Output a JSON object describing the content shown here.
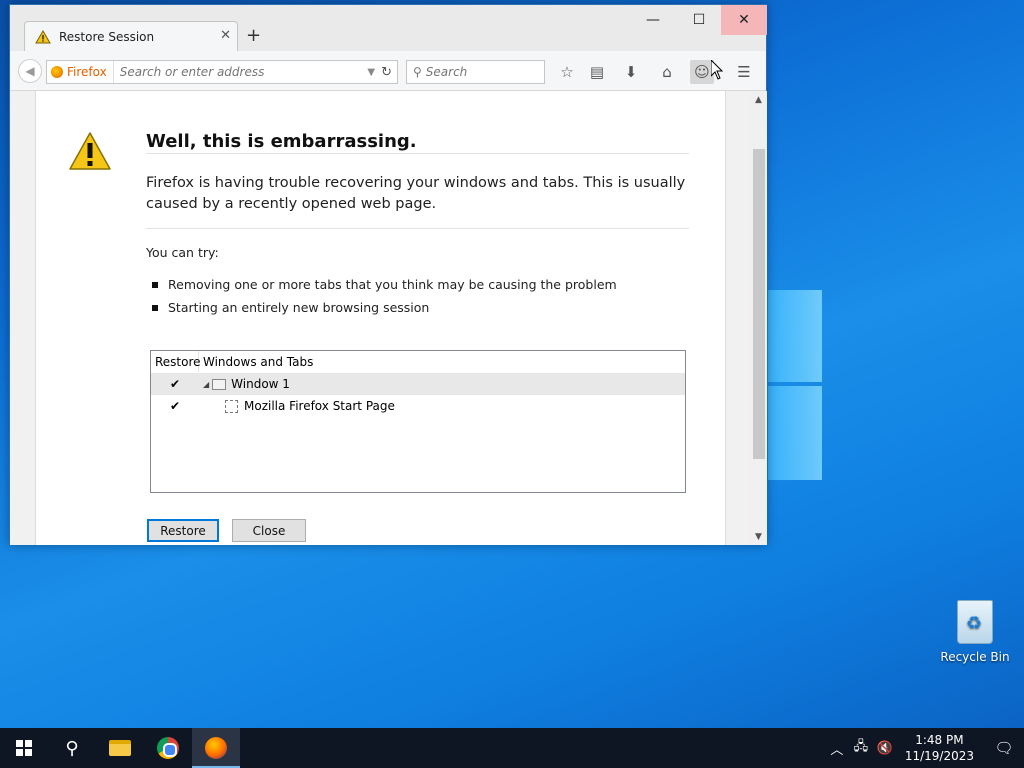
{
  "browser": {
    "tab_title": "Restore Session",
    "new_tab_label": "+",
    "window_controls": {
      "minimize": "—",
      "maximize": "☐",
      "close": "✕"
    },
    "urlbar": {
      "identity": "Firefox",
      "placeholder": "Search or enter address"
    },
    "search": {
      "placeholder": "Search"
    }
  },
  "page": {
    "heading": "Well, this is embarrassing.",
    "description": "Firefox is having trouble recovering your windows and tabs. This is usually caused by a recently opened web page.",
    "try_label": "You can try:",
    "suggestions": [
      "Removing one or more tabs that you think may be causing the problem",
      "Starting an entirely new browsing session"
    ],
    "tree": {
      "columns": [
        "Restore",
        "Windows and Tabs"
      ],
      "rows": [
        {
          "checked": "✔",
          "label": "Window 1"
        },
        {
          "checked": "✔",
          "label": "Mozilla Firefox Start Page"
        }
      ]
    },
    "buttons": {
      "restore": "Restore",
      "close": "Close"
    }
  },
  "desktop": {
    "recycle_bin": "Recycle Bin"
  },
  "taskbar": {
    "time": "1:48 PM",
    "date": "11/19/2023"
  }
}
